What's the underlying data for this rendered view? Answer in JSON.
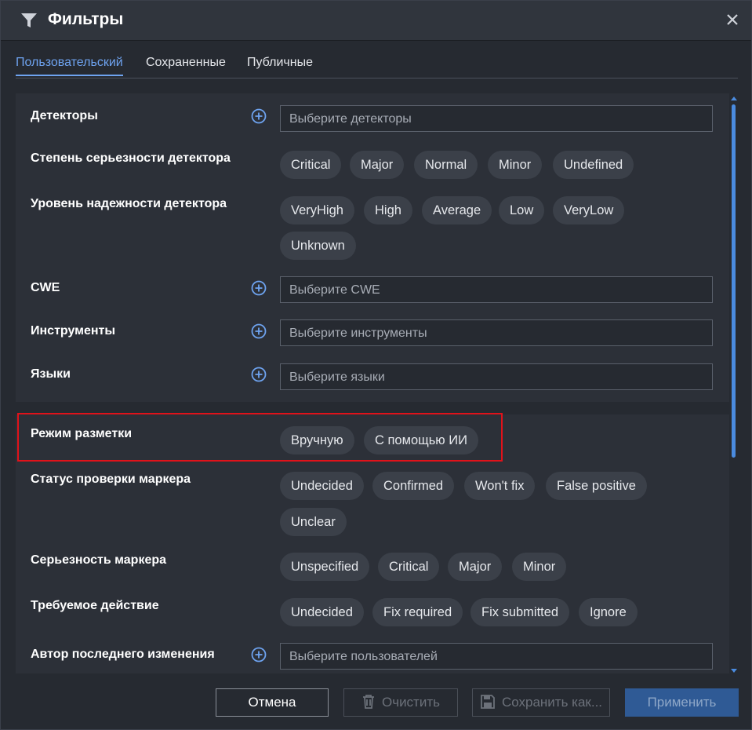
{
  "dialog": {
    "title": "Фильтры",
    "title_icon": "filter-icon",
    "close_icon": "close-icon"
  },
  "tabs": [
    {
      "label": "Пользовательский",
      "active": true
    },
    {
      "label": "Сохраненные",
      "active": false
    },
    {
      "label": "Публичные",
      "active": false
    }
  ],
  "filters": {
    "detectors": {
      "label": "Детекторы",
      "placeholder": "Выберите детекторы"
    },
    "severity": {
      "label": "Степень серьезности детектора",
      "options": [
        "Critical",
        "Major",
        "Normal",
        "Minor",
        "Undefined"
      ]
    },
    "reliability": {
      "label": "Уровень надежности детектора",
      "options": [
        "VeryHigh",
        "High",
        "Average",
        "Low",
        "VeryLow",
        "Unknown"
      ]
    },
    "cwe": {
      "label": "CWE",
      "placeholder": "Выберите CWE"
    },
    "tools": {
      "label": "Инструменты",
      "placeholder": "Выберите инструменты"
    },
    "languages": {
      "label": "Языки",
      "placeholder": "Выберите языки"
    },
    "markup_mode": {
      "label": "Режим разметки",
      "options": [
        "Вручную",
        "С помощью ИИ"
      ]
    },
    "marker_status": {
      "label": "Статус проверки маркера",
      "options": [
        "Undecided",
        "Confirmed",
        "Won't fix",
        "False positive",
        "Unclear"
      ]
    },
    "marker_severity": {
      "label": "Серьезность маркера",
      "options": [
        "Unspecified",
        "Critical",
        "Major",
        "Minor"
      ]
    },
    "required_action": {
      "label": "Требуемое действие",
      "options": [
        "Undecided",
        "Fix required",
        "Fix submitted",
        "Ignore"
      ]
    },
    "last_author": {
      "label": "Автор последнего изменения",
      "placeholder": "Выберите пользователей"
    }
  },
  "footer": {
    "cancel": "Отмена",
    "clear": "Очистить",
    "save_as": "Сохранить как...",
    "apply": "Применить"
  },
  "colors": {
    "accent": "#6ea3f0",
    "highlight": "#e0121a",
    "apply_button": "#2f5a95"
  }
}
